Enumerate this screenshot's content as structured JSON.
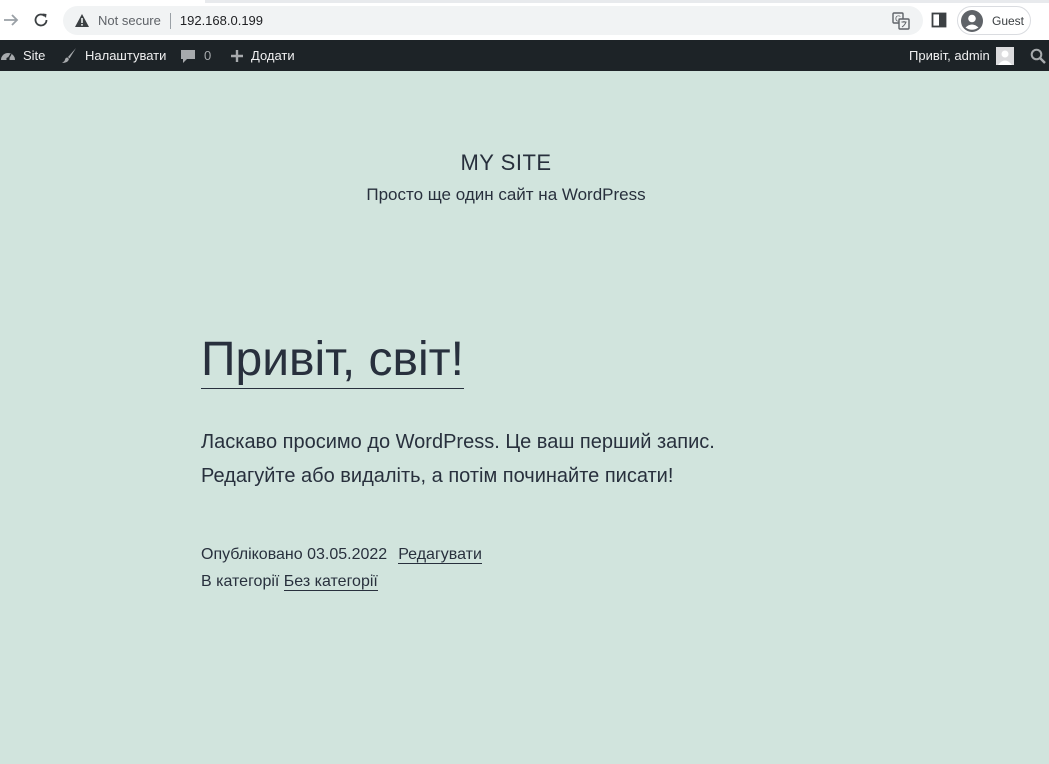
{
  "browser": {
    "security_label": "Not secure",
    "url": "192.168.0.199",
    "profile_label": "Guest"
  },
  "admin_bar": {
    "site_label": "Site",
    "customize_label": "Налаштувати",
    "comments_count": "0",
    "new_label": "Додати",
    "greeting": "Привіт, admin"
  },
  "site": {
    "title": "MY SITE",
    "description": "Просто ще один сайт на WordPress"
  },
  "post": {
    "title": "Привіт, світ!",
    "body_line1": "Ласкаво просимо до WordPress. Це ваш перший запис.",
    "body_line2": "Редагуйте або видаліть, а потім починайте писати!",
    "published_label": "Опубліковано 03.05.2022",
    "edit_label": "Редагувати",
    "category_prefix": "В категорії",
    "category_label": "Без категорії"
  },
  "icons": {
    "forward": "arrow-forward-icon",
    "reload": "reload-icon",
    "warning": "warning-triangle-icon",
    "translate": "translate-icon",
    "side_panel": "side-panel-icon",
    "profile": "profile-avatar-icon",
    "dashboard": "dashboard-icon",
    "brush": "brush-icon",
    "comment": "comment-icon",
    "plus": "plus-icon",
    "search": "search-icon"
  }
}
